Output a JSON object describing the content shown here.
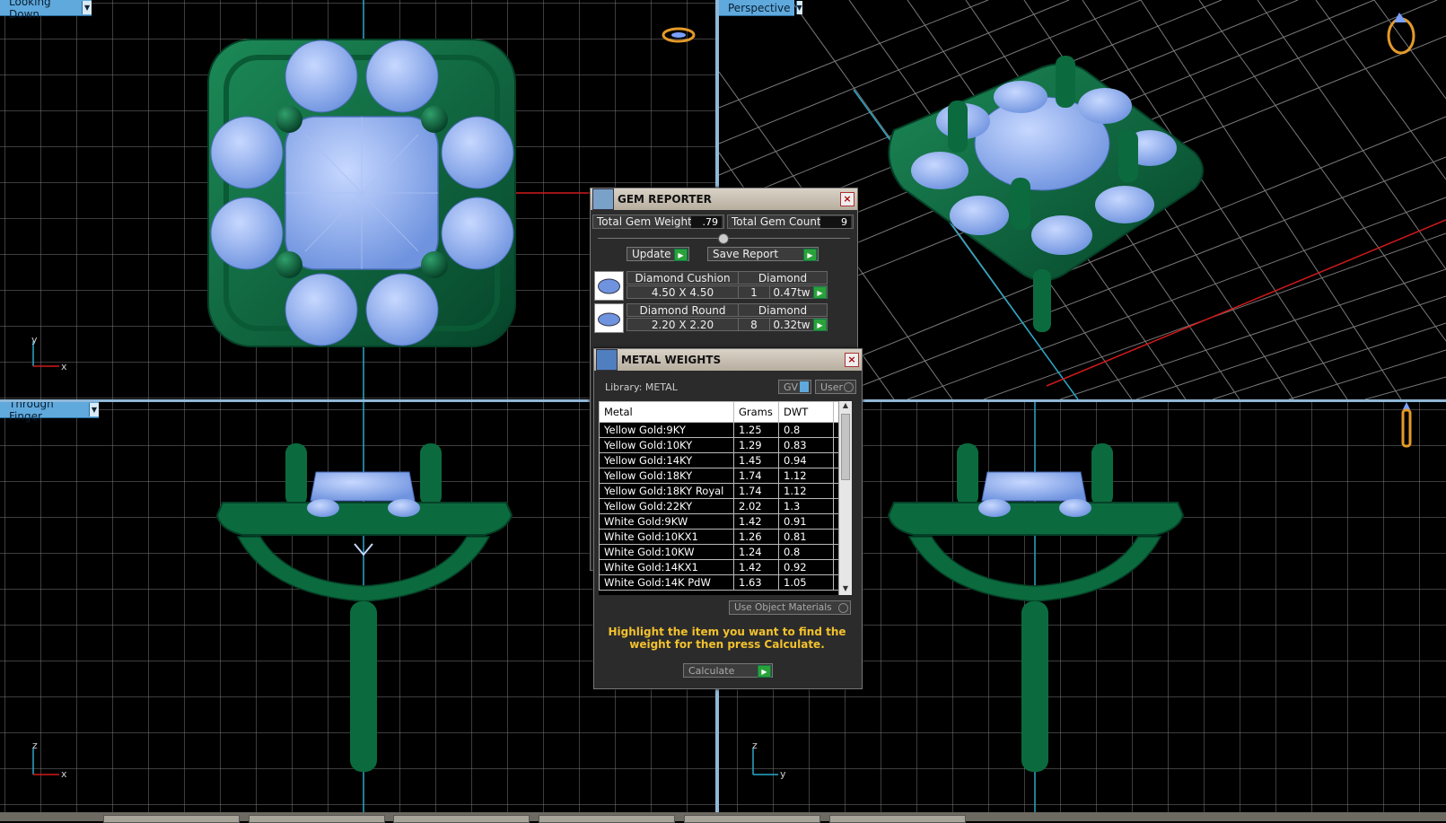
{
  "viewports": {
    "top_left": {
      "label": "Looking Down",
      "axes": [
        "y",
        "x"
      ]
    },
    "top_right": {
      "label": "Perspective"
    },
    "bottom_left": {
      "label": "Through Finger",
      "axes": [
        "z",
        "x"
      ]
    },
    "bottom_right": {
      "axes": [
        "z",
        "y"
      ]
    }
  },
  "gem_reporter": {
    "title": "GEM REPORTER",
    "close": "×",
    "total_weight_label": "Total Gem Weight",
    "total_weight": ".79",
    "total_count_label": "Total Gem Count",
    "total_count": "9",
    "update_label": "Update",
    "save_label": "Save Report",
    "gems": [
      {
        "name": "Diamond Cushion",
        "type": "Diamond",
        "size": "4.50 X 4.50",
        "count": "1",
        "weight": "0.47tw"
      },
      {
        "name": "Diamond Round",
        "type": "Diamond",
        "size": "2.20 X 2.20",
        "count": "8",
        "weight": "0.32tw"
      }
    ]
  },
  "metal_weights": {
    "title": "METAL WEIGHTS",
    "close": "×",
    "library": "Library: METAL",
    "gv_label": "GV",
    "user_label": "User",
    "columns": [
      "Metal",
      "Grams",
      "DWT"
    ],
    "rows": [
      [
        "Yellow Gold:9KY",
        "1.25",
        "0.8"
      ],
      [
        "Yellow Gold:10KY",
        "1.29",
        "0.83"
      ],
      [
        "Yellow Gold:14KY",
        "1.45",
        "0.94"
      ],
      [
        "Yellow Gold:18KY",
        "1.74",
        "1.12"
      ],
      [
        "Yellow Gold:18KY Royal",
        "1.74",
        "1.12"
      ],
      [
        "Yellow Gold:22KY",
        "2.02",
        "1.3"
      ],
      [
        "White Gold:9KW",
        "1.42",
        "0.91"
      ],
      [
        "White Gold:10KX1",
        "1.26",
        "0.81"
      ],
      [
        "White Gold:10KW",
        "1.24",
        "0.8"
      ],
      [
        "White Gold:14KX1",
        "1.42",
        "0.92"
      ],
      [
        "White Gold:14K PdW",
        "1.63",
        "1.05"
      ]
    ],
    "use_object_materials": "Use Object Materials",
    "hint": "Highlight the item you want to find the weight for then press Calculate.",
    "calculate_label": "Calculate"
  },
  "colors": {
    "metal": "#0b6b3e",
    "gem": "#8fb2ee",
    "grid": "#7a7a7a",
    "viewport_label": "#5fa9dd"
  },
  "icons": [
    "ring-view-icon",
    "ring-perspective-icon",
    "ring-side-icon",
    "gem-icon",
    "metal-flask-icon",
    "go-arrow-icon"
  ]
}
